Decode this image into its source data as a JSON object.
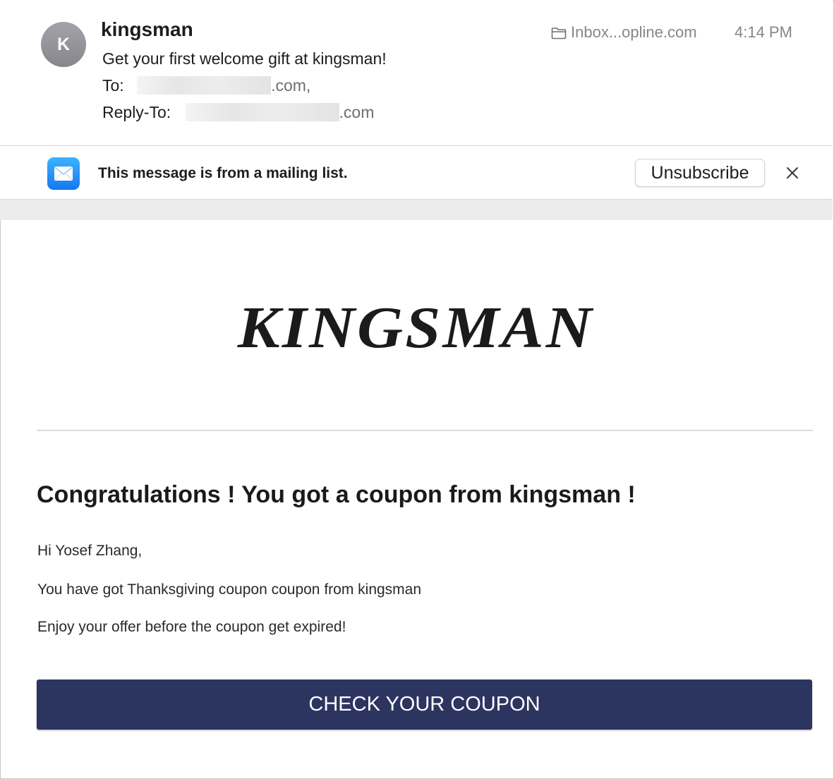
{
  "header": {
    "avatar_initial": "K",
    "sender": "kingsman",
    "subject": "Get your first welcome gift at kingsman!",
    "to_label": "To:",
    "to_value_suffix": ".com,",
    "reply_to_label": "Reply-To:",
    "reply_to_value_suffix": ".com",
    "folder": "Inbox...opline.com",
    "folder_icon": "folder-icon",
    "time": "4:14 PM"
  },
  "banner": {
    "icon": "mail-app-icon",
    "text": "This message is from a mailing list.",
    "unsubscribe_label": "Unsubscribe",
    "close_icon": "close-icon"
  },
  "email": {
    "logo_text": "KINGSMAN",
    "headline": "Congratulations ! You got a coupon from kingsman !",
    "greeting": "Hi Yosef Zhang,",
    "line1": "You have got Thanksgiving coupon coupon from kingsman",
    "line2": "Enjoy your offer before the coupon get expired!",
    "cta_label": "CHECK YOUR COUPON"
  },
  "colors": {
    "cta_background": "#2c3560",
    "avatar_background": "#8e8e93",
    "mail_icon_blue": "#1a7ef5"
  }
}
